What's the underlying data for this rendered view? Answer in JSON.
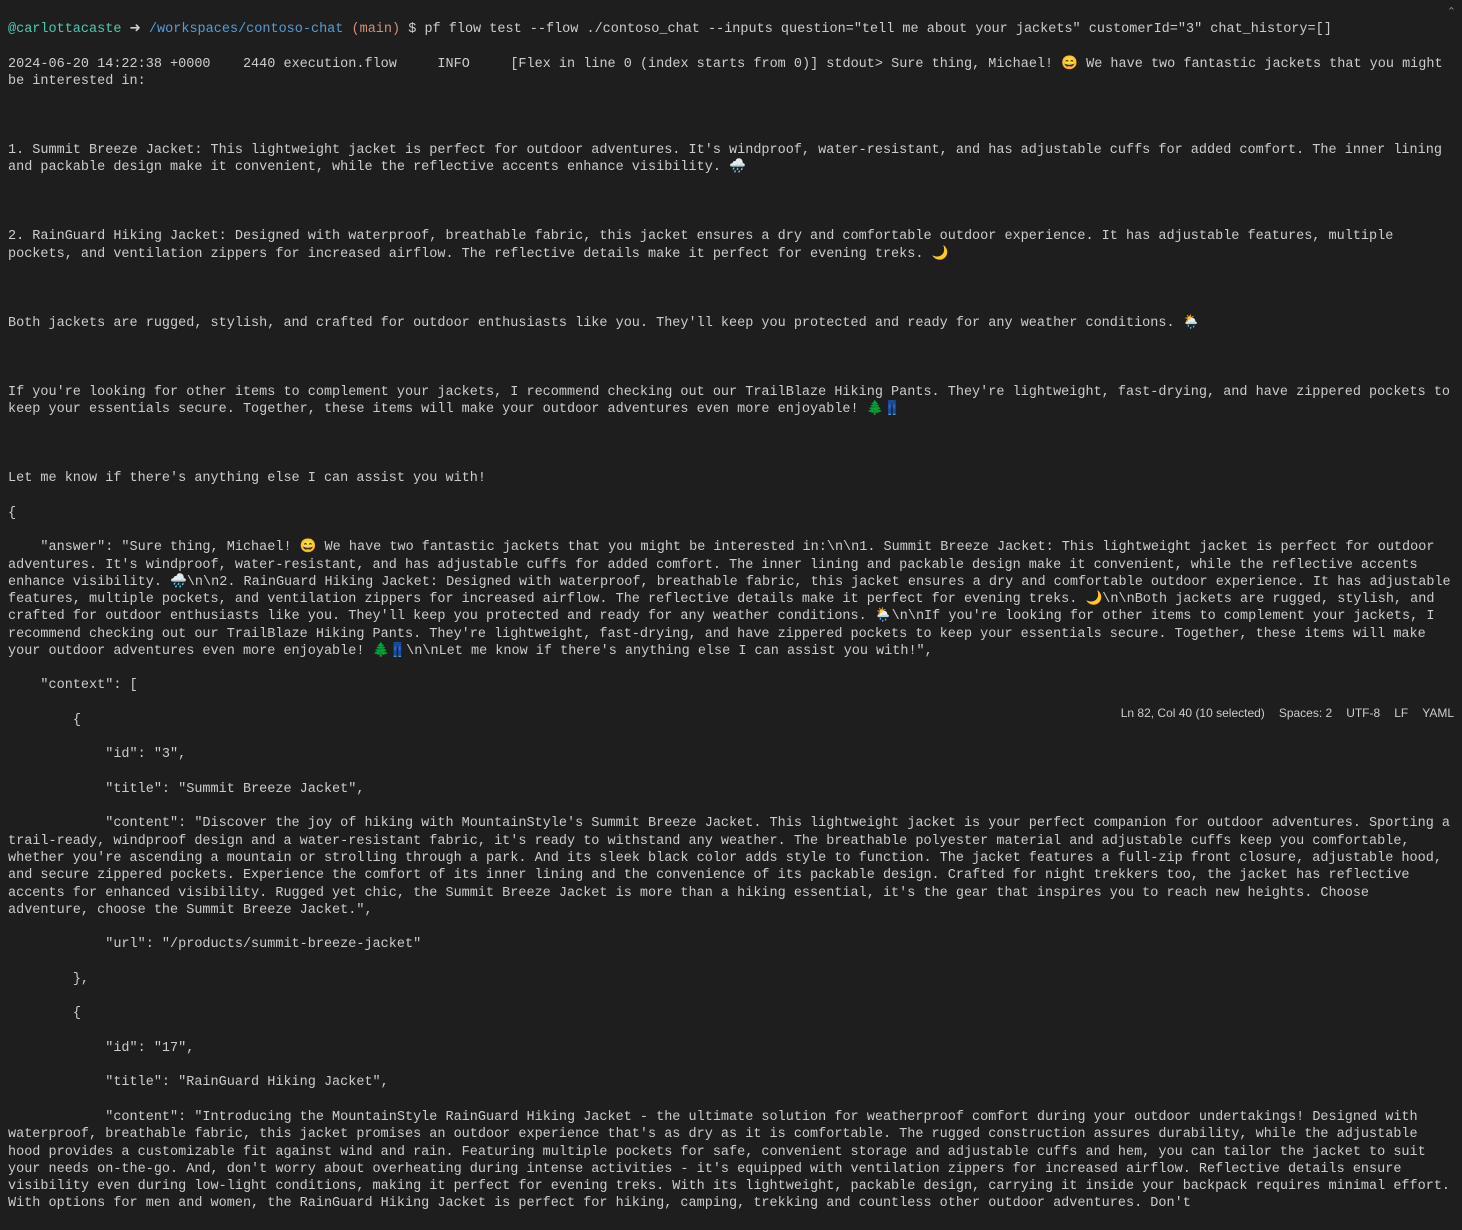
{
  "prompt": {
    "username": "@carlottacaste",
    "arrow": "➜",
    "path": "/workspaces/contoso-chat",
    "branch_open": "(",
    "branch": "main",
    "branch_close": ")",
    "dollar": "$",
    "command": "pf flow test --flow ./contoso_chat --inputs question=\"tell me about your jackets\" customerId=\"3\" chat_history=[]"
  },
  "log": {
    "timestamp": "2024-06-20 14:22:38 +0000",
    "pid": "2440",
    "module": "execution.flow",
    "level": "INFO",
    "prefix": "[Flex in line 0 (index starts from 0)] stdout> ",
    "intro": "Sure thing, Michael! 😄 We have two fantastic jackets that you might be interested in:"
  },
  "body": {
    "p1": "1. Summit Breeze Jacket: This lightweight jacket is perfect for outdoor adventures. It's windproof, water-resistant, and has adjustable cuffs for added comfort. The inner lining and packable design make it convenient, while the reflective accents enhance visibility. 🌧️",
    "p2": "2. RainGuard Hiking Jacket: Designed with waterproof, breathable fabric, this jacket ensures a dry and comfortable outdoor experience. It has adjustable features, multiple pockets, and ventilation zippers for increased airflow. The reflective details make it perfect for evening treks. 🌙",
    "p3": "Both jackets are rugged, stylish, and crafted for outdoor enthusiasts like you. They'll keep you protected and ready for any weather conditions. 🌦️",
    "p4": "If you're looking for other items to complement your jackets, I recommend checking out our TrailBlaze Hiking Pants. They're lightweight, fast-drying, and have zippered pockets to keep your essentials secure. Together, these items will make your outdoor adventures even more enjoyable! 🌲👖",
    "p5": "Let me know if there's anything else I can assist you with!"
  },
  "json_output": {
    "open_brace": "{",
    "answer_line": "    \"answer\": \"Sure thing, Michael! 😄 We have two fantastic jackets that you might be interested in:\\n\\n1. Summit Breeze Jacket: This lightweight jacket is perfect for outdoor adventures. It's windproof, water-resistant, and has adjustable cuffs for added comfort. The inner lining and packable design make it convenient, while the reflective accents enhance visibility. 🌧️\\n\\n2. RainGuard Hiking Jacket: Designed with waterproof, breathable fabric, this jacket ensures a dry and comfortable outdoor experience. It has adjustable features, multiple pockets, and ventilation zippers for increased airflow. The reflective details make it perfect for evening treks. 🌙\\n\\nBoth jackets are rugged, stylish, and crafted for outdoor enthusiasts like you. They'll keep you protected and ready for any weather conditions. 🌦️\\n\\nIf you're looking for other items to complement your jackets, I recommend checking out our TrailBlaze Hiking Pants. They're lightweight, fast-drying, and have zippered pockets to keep your essentials secure. Together, these items will make your outdoor adventures even more enjoyable! 🌲👖\\n\\nLet me know if there's anything else I can assist you with!\",",
    "context_open": "    \"context\": [",
    "item1_open": "        {",
    "item1_id": "            \"id\": \"3\",",
    "item1_title": "            \"title\": \"Summit Breeze Jacket\",",
    "item1_content": "            \"content\": \"Discover the joy of hiking with MountainStyle's Summit Breeze Jacket. This lightweight jacket is your perfect companion for outdoor adventures. Sporting a trail-ready, windproof design and a water-resistant fabric, it's ready to withstand any weather. The breathable polyester material and adjustable cuffs keep you comfortable, whether you're ascending a mountain or strolling through a park. And its sleek black color adds style to function. The jacket features a full-zip front closure, adjustable hood, and secure zippered pockets. Experience the comfort of its inner lining and the convenience of its packable design. Crafted for night trekkers too, the jacket has reflective accents for enhanced visibility. Rugged yet chic, the Summit Breeze Jacket is more than a hiking essential, it's the gear that inspires you to reach new heights. Choose adventure, choose the Summit Breeze Jacket.\",",
    "item1_url": "            \"url\": \"/products/summit-breeze-jacket\"",
    "item1_close": "        },",
    "item2_open": "        {",
    "item2_id": "            \"id\": \"17\",",
    "item2_title": "            \"title\": \"RainGuard Hiking Jacket\",",
    "item2_content": "            \"content\": \"Introducing the MountainStyle RainGuard Hiking Jacket - the ultimate solution for weatherproof comfort during your outdoor undertakings! Designed with waterproof, breathable fabric, this jacket promises an outdoor experience that's as dry as it is comfortable. The rugged construction assures durability, while the adjustable hood provides a customizable fit against wind and rain. Featuring multiple pockets for safe, convenient storage and adjustable cuffs and hem, you can tailor the jacket to suit your needs on-the-go. And, don't worry about overheating during intense activities - it's equipped with ventilation zippers for increased airflow. Reflective details ensure visibility even during low-light conditions, making it perfect for evening treks. With its lightweight, packable design, carrying it inside your backpack requires minimal effort. With options for men and women, the RainGuard Hiking Jacket is perfect for hiking, camping, trekking and countless other outdoor adventures. Don't"
  },
  "status_bar": {
    "ln_col": "Ln 82, Col 40 (10 selected)",
    "spaces": "Spaces: 2",
    "encoding": "UTF-8",
    "eol": "LF",
    "lang": "YAML"
  },
  "scroll_indicator": "⌃"
}
